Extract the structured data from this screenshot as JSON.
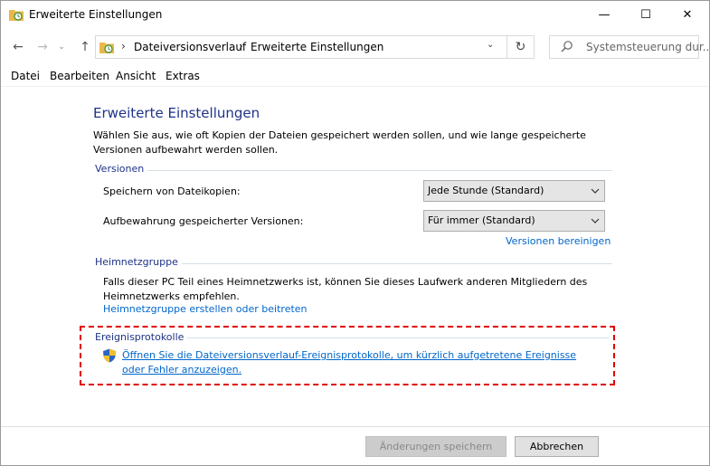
{
  "window": {
    "title": "Erweiterte Einstellungen",
    "controls": {
      "minimize": "—",
      "maximize": "☐",
      "close": "✕"
    }
  },
  "nav": {
    "back": "←",
    "forward": "→",
    "recent": "⌄",
    "up": "↑",
    "breadcrumb_sep": "›",
    "breadcrumb": [
      "Dateiversionsverlauf",
      "Erweiterte Einstellungen"
    ],
    "dropdown": "⌄",
    "refresh": "↻",
    "search_placeholder": "Systemsteuerung dur..."
  },
  "menu": [
    "Datei",
    "Bearbeiten",
    "Ansicht",
    "Extras"
  ],
  "content": {
    "heading": "Erweiterte Einstellungen",
    "intro": "Wählen Sie aus, wie oft Kopien der Dateien gespeichert werden sollen, und wie lange gespeicherte Versionen aufbewahrt werden sollen.",
    "versions": {
      "label": "Versionen",
      "save_copies_label": "Speichern von Dateikopien:",
      "save_copies_value": "Jede Stunde (Standard)",
      "retention_label": "Aufbewahrung gespeicherter Versionen:",
      "retention_value": "Für immer (Standard)",
      "cleanup_link": "Versionen bereinigen"
    },
    "homegroup": {
      "label": "Heimnetzgruppe",
      "text": "Falls dieser PC Teil eines Heimnetzwerks ist, können Sie dieses Laufwerk anderen Mitgliedern des Heimnetzwerks empfehlen.",
      "link": "Heimnetzgruppe erstellen oder beitreten"
    },
    "events": {
      "label": "Ereignisprotokolle",
      "link": "Öffnen Sie die Dateiversionsverlauf-Ereignisprotokolle, um kürzlich aufgetretene Ereignisse oder Fehler anzuzeigen."
    }
  },
  "footer": {
    "save_label": "Änderungen speichern",
    "cancel_label": "Abbrechen"
  },
  "colors": {
    "heading": "#1e3287",
    "link": "#0066cc",
    "highlight_border": "#e00000"
  },
  "icons": {
    "window": "folder-history-icon",
    "shield": "uac-shield-icon"
  }
}
